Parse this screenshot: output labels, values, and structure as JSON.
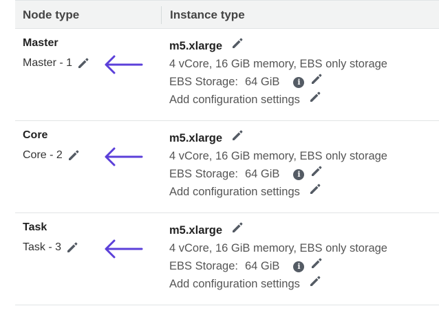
{
  "table": {
    "headers": {
      "node_type": "Node type",
      "instance_type": "Instance type"
    },
    "rows": [
      {
        "node_type": "Master",
        "count_label": "Master - 1",
        "instance": {
          "type": "m5.xlarge",
          "specs": "4 vCore, 16 GiB memory, EBS only storage",
          "ebs_label": "EBS Storage:",
          "ebs_value": "64 GiB",
          "config_link": "Add configuration settings"
        }
      },
      {
        "node_type": "Core",
        "count_label": "Core - 2",
        "instance": {
          "type": "m5.xlarge",
          "specs": "4 vCore, 16 GiB memory, EBS only storage",
          "ebs_label": "EBS Storage:",
          "ebs_value": "64 GiB",
          "config_link": "Add configuration settings"
        }
      },
      {
        "node_type": "Task",
        "count_label": "Task - 3",
        "instance": {
          "type": "m5.xlarge",
          "specs": "4 vCore, 16 GiB memory, EBS only storage",
          "ebs_label": "EBS Storage:",
          "ebs_value": "64 GiB",
          "config_link": "Add configuration settings"
        }
      }
    ]
  },
  "icons": {
    "edit": "pencil-icon",
    "info": "info-icon",
    "annotation": "arrow-left-icon",
    "info_glyph": "i"
  },
  "colors": {
    "arrow": "#5b3fd9",
    "pencil": "#545b64",
    "header_bg": "#f2f3f3"
  }
}
